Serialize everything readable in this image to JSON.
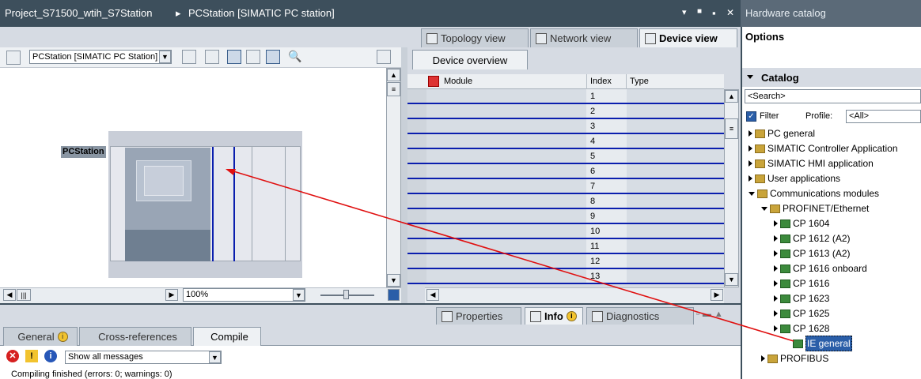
{
  "editor": {
    "title": "Project_S71500_wtih_S7Station",
    "sep": "▸",
    "subtitle": "PCStation [SIMATIC PC station]",
    "win_buttons": [
      "▾",
      "■",
      "▪",
      "✕"
    ]
  },
  "view_tabs": [
    {
      "label": "Topology view",
      "icon": "topology-icon"
    },
    {
      "label": "Network view",
      "icon": "network-icon"
    },
    {
      "label": "Device view",
      "icon": "device-icon",
      "active": true
    }
  ],
  "device_select": {
    "value": "PCStation [SIMATIC PC Station]"
  },
  "canvas": {
    "station_label": "PCStation",
    "zoom": "100%"
  },
  "overview": {
    "tab": "Device overview",
    "columns": [
      "Module",
      "Index",
      "Type"
    ],
    "rows": [
      "1",
      "2",
      "3",
      "4",
      "5",
      "6",
      "7",
      "8",
      "9",
      "10",
      "11",
      "12",
      "13"
    ]
  },
  "inspector": {
    "tabs": [
      "Properties",
      "Info",
      "Diagnostics"
    ],
    "subtabs": [
      "General",
      "Cross-references",
      "Compile"
    ],
    "filter": "Show all messages",
    "status": "Compiling finished (errors: 0; warnings: 0)"
  },
  "catalog": {
    "header": "Hardware catalog",
    "options": "Options",
    "section": "Catalog",
    "search": "<Search>",
    "filter_label": "Filter",
    "profile_label": "Profile:",
    "profile_value": "<All>",
    "items": [
      {
        "label": "PC general",
        "level": 0,
        "open": false,
        "icon": "folder-icon"
      },
      {
        "label": "SIMATIC Controller Application",
        "level": 0,
        "open": false,
        "icon": "folder-icon"
      },
      {
        "label": "SIMATIC HMI application",
        "level": 0,
        "open": false,
        "icon": "folder-icon"
      },
      {
        "label": "User applications",
        "level": 0,
        "open": false,
        "icon": "folder-icon"
      },
      {
        "label": "Communications modules",
        "level": 0,
        "open": true,
        "icon": "folder-icon"
      },
      {
        "label": "PROFINET/Ethernet",
        "level": 1,
        "open": true,
        "icon": "folder-icon"
      },
      {
        "label": "CP 1604",
        "level": 2,
        "open": false,
        "icon": "module-icon"
      },
      {
        "label": "CP 1612 (A2)",
        "level": 2,
        "open": false,
        "icon": "module-icon"
      },
      {
        "label": "CP 1613 (A2)",
        "level": 2,
        "open": false,
        "icon": "module-icon"
      },
      {
        "label": "CP 1616 onboard",
        "level": 2,
        "open": false,
        "icon": "module-icon"
      },
      {
        "label": "CP 1616",
        "level": 2,
        "open": false,
        "icon": "module-icon"
      },
      {
        "label": "CP 1623",
        "level": 2,
        "open": false,
        "icon": "module-icon"
      },
      {
        "label": "CP 1625",
        "level": 2,
        "open": false,
        "icon": "module-icon"
      },
      {
        "label": "CP 1628",
        "level": 2,
        "open": false,
        "icon": "module-icon"
      },
      {
        "label": "IE general",
        "level": 3,
        "selected": true,
        "icon": "module-icon"
      },
      {
        "label": "PROFIBUS",
        "level": 1,
        "open": false,
        "icon": "folder-icon"
      }
    ]
  },
  "colors": {
    "titlebar": "#3d4f5c",
    "rowline": "#0a1eae",
    "arrow": "#e01010"
  }
}
